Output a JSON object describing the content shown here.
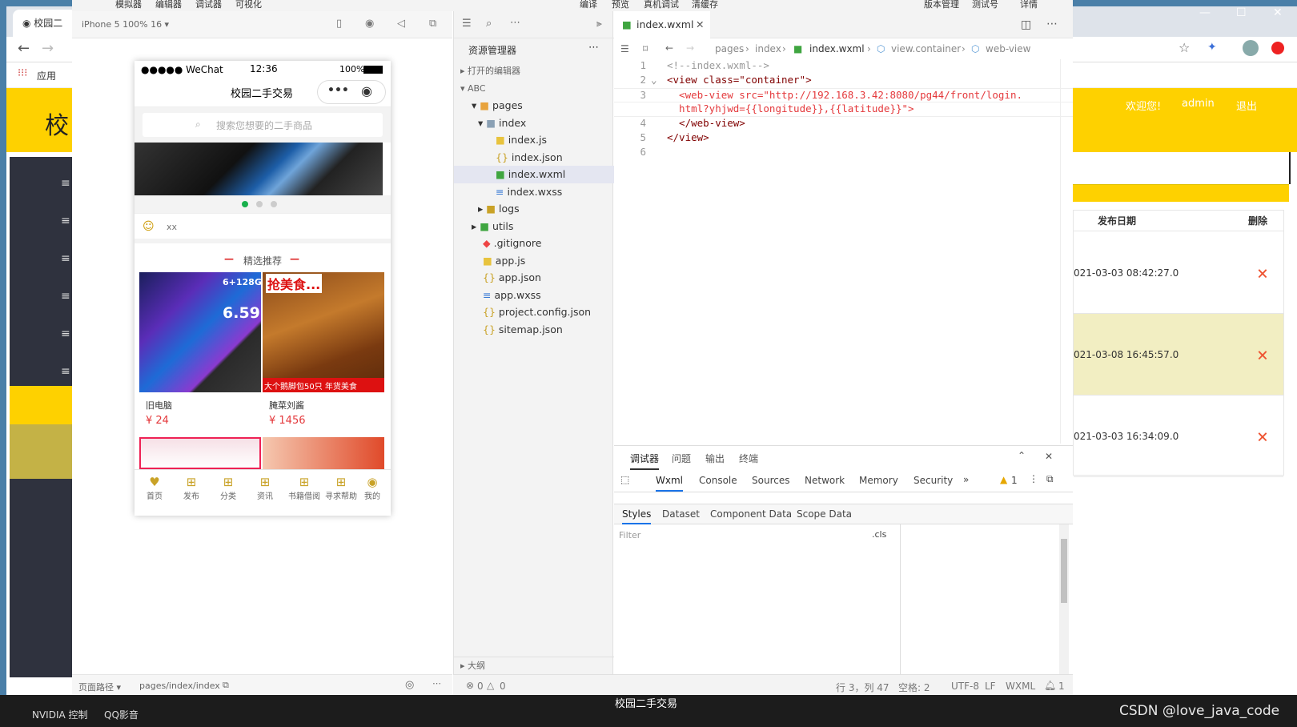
{
  "bg_browser": {
    "tab_title": "校园二",
    "bookmark_apps": "应用",
    "header_char": "校",
    "welcome": "欢迎您!",
    "user": "admin",
    "logout": "退出",
    "table": {
      "col_date": "发布日期",
      "col_delete": "删除",
      "rows": [
        {
          "date": "021-03-03 08:42:27.0"
        },
        {
          "date": "021-03-08 16:45:57.0"
        },
        {
          "date": "021-03-03 16:34:09.0"
        }
      ]
    },
    "page_title_bottom": "校园二手交易"
  },
  "menu": [
    "模拟器",
    "编辑器",
    "调试器",
    "可视化",
    "编译",
    "预览",
    "真机调试",
    "清缓存",
    "版本管理",
    "测试号",
    "详情"
  ],
  "simulator": {
    "device": "iPhone 5 100% 16 ▾",
    "status": {
      "carrier": "●●●●● WeChat",
      "time": "12:36",
      "battery": "100%"
    },
    "nav_title": "校园二手交易",
    "search_placeholder": "搜索您想要的二手商品",
    "notice": "xx",
    "section_title": "精选推荐",
    "products": [
      {
        "name": "旧电脑",
        "price": "¥ 24",
        "img_text": "6+128G",
        "img_big": "6.59"
      },
      {
        "name": "腌菜刘酱",
        "price": "¥ 1456",
        "img_text": "抢美食...",
        "img_band": "大个鹅脚包50只 年货美食"
      }
    ],
    "tabbar": [
      "首页",
      "发布",
      "分类",
      "资讯",
      "书籍借阅",
      "寻求帮助",
      "我的"
    ],
    "bottom": {
      "path_label": "页面路径 ▾",
      "path": "pages/index/index"
    }
  },
  "explorer": {
    "title": "资源管理器",
    "open_editors": "打开的编辑器",
    "project": "ABC",
    "outline": "大纲",
    "items": [
      {
        "label": "pages",
        "type": "folder"
      },
      {
        "label": "index",
        "type": "folder"
      },
      {
        "label": "index.js",
        "type": "js"
      },
      {
        "label": "index.json",
        "type": "json"
      },
      {
        "label": "index.wxml",
        "type": "wxml"
      },
      {
        "label": "index.wxss",
        "type": "wxss"
      },
      {
        "label": "logs",
        "type": "folder"
      },
      {
        "label": "utils",
        "type": "folder"
      },
      {
        "label": ".gitignore",
        "type": "git"
      },
      {
        "label": "app.js",
        "type": "js"
      },
      {
        "label": "app.json",
        "type": "json"
      },
      {
        "label": "app.wxss",
        "type": "wxss"
      },
      {
        "label": "project.config.json",
        "type": "json"
      },
      {
        "label": "sitemap.json",
        "type": "json"
      }
    ]
  },
  "editor": {
    "tab": "index.wxml",
    "breadcrumb": [
      "pages",
      "index",
      "index.wxml",
      "view.container",
      "web-view"
    ],
    "lines": [
      {
        "n": "1",
        "text": "<!--index.wxml-->"
      },
      {
        "n": "2",
        "text": "<view class=\"container\">"
      },
      {
        "n": "3",
        "text": "  <web-view src=\"http://192.168.3.42:8080/pg44/front/login."
      },
      {
        "n": "",
        "text": "  html?yhjwd={{longitude}},{{latitude}}\">"
      },
      {
        "n": "4",
        "text": "  </web-view>"
      },
      {
        "n": "5",
        "text": "</view>"
      },
      {
        "n": "6",
        "text": ""
      }
    ]
  },
  "debugger": {
    "panel_tabs": [
      "调试器",
      "问题",
      "输出",
      "终端"
    ],
    "tabs": [
      "Wxml",
      "Console",
      "Sources",
      "Network",
      "Memory",
      "Security"
    ],
    "warn_count": "1",
    "sub_tabs": [
      "Styles",
      "Dataset",
      "Component Data",
      "Scope Data"
    ],
    "filter_placeholder": "Filter",
    "cls": ".cls"
  },
  "status_bar": {
    "errors": "0",
    "warnings": "0",
    "position": "行 3，列 47",
    "spaces": "空格: 2",
    "encoding": "UTF-8",
    "eol": "LF",
    "lang": "WXML",
    "notif": "1"
  },
  "taskbar": [
    "NVIDIA 控制",
    "QQ影音"
  ],
  "watermark": "CSDN @love_java_code"
}
